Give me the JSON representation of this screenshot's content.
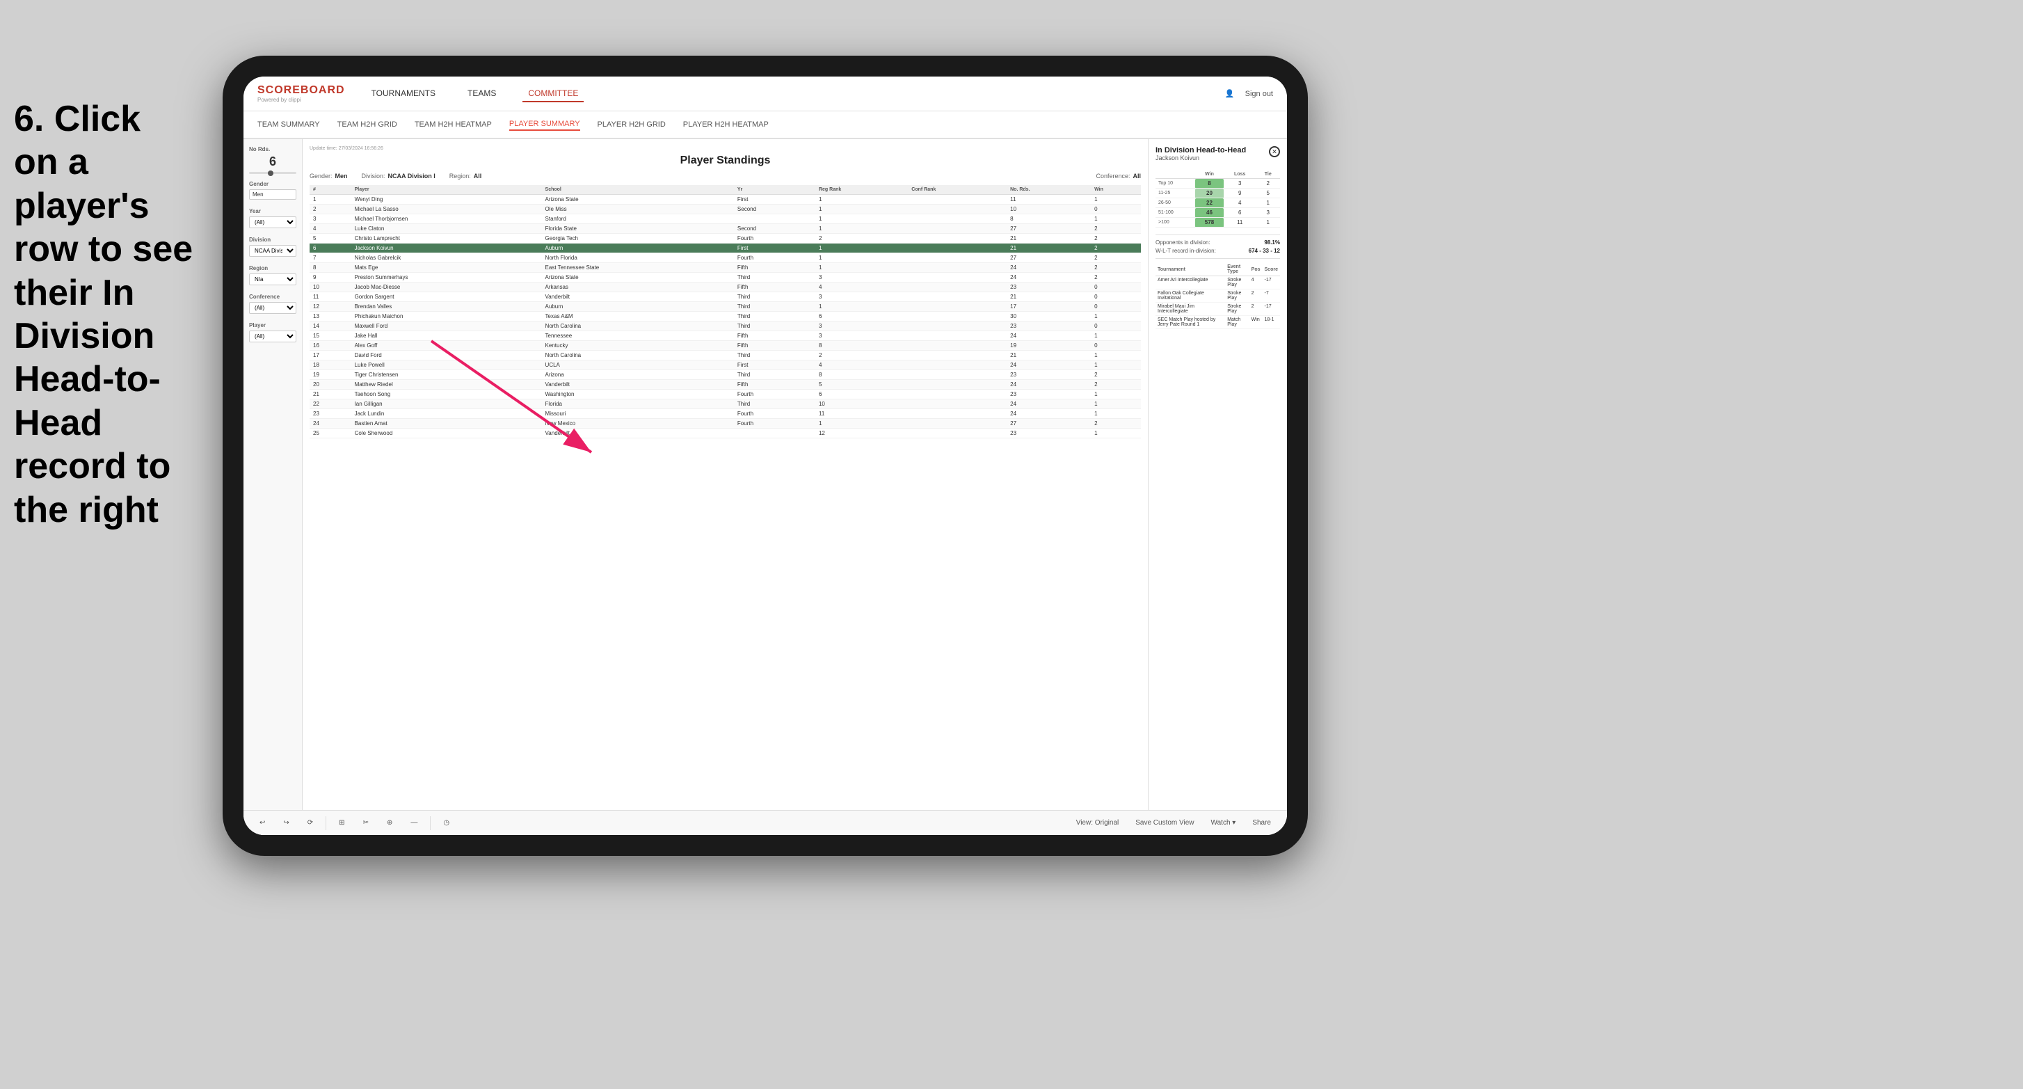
{
  "instruction": {
    "text": "6. Click on a player's row to see their In Division Head-to-Head record to the right"
  },
  "app": {
    "logo": "SCOREBOARD",
    "logo_sub": "Powered by clippi",
    "nav_items": [
      "TOURNAMENTS",
      "TEAMS",
      "COMMITTEE"
    ],
    "sign_out": "Sign out",
    "secondary_nav": [
      "TEAM SUMMARY",
      "TEAM H2H GRID",
      "TEAM H2H HEATMAP",
      "PLAYER SUMMARY",
      "PLAYER H2H GRID",
      "PLAYER H2H HEATMAP"
    ],
    "active_nav": "PLAYER SUMMARY"
  },
  "filters": {
    "no_rds_label": "No Rds.",
    "no_rds_value": "6",
    "gender_label": "Gender",
    "gender_value": "Men",
    "year_label": "Year",
    "year_value": "(All)",
    "division_label": "Division",
    "division_value": "NCAA Division I",
    "region_label": "Region",
    "region_value": "N/a",
    "conference_label": "Conference",
    "conference_value": "(All)",
    "player_label": "Player",
    "player_value": "(All)"
  },
  "standings": {
    "title": "Player Standings",
    "update_time": "Update time: 27/03/2024 16:56:26",
    "gender": "Men",
    "division": "NCAA Division I",
    "region": "All",
    "conference": "All",
    "columns": [
      "#",
      "Player",
      "School",
      "Yr",
      "Reg Rank",
      "Conf Rank",
      "No. Rds.",
      "Win"
    ],
    "rows": [
      {
        "num": 1,
        "player": "Wenyi Ding",
        "school": "Arizona State",
        "yr": "First",
        "reg_rank": 1,
        "conf_rank": "",
        "no_rds": 11,
        "win": 1
      },
      {
        "num": 2,
        "player": "Michael La Sasso",
        "school": "Ole Miss",
        "yr": "Second",
        "reg_rank": 1,
        "conf_rank": "",
        "no_rds": 10,
        "win": 0
      },
      {
        "num": 3,
        "player": "Michael Thorbjornsen",
        "school": "Stanford",
        "yr": "",
        "reg_rank": 1,
        "conf_rank": "",
        "no_rds": 8,
        "win": 1
      },
      {
        "num": 4,
        "player": "Luke Claton",
        "school": "Florida State",
        "yr": "Second",
        "reg_rank": 1,
        "conf_rank": "",
        "no_rds": 27,
        "win": 2
      },
      {
        "num": 5,
        "player": "Christo Lamprecht",
        "school": "Georgia Tech",
        "yr": "Fourth",
        "reg_rank": 2,
        "conf_rank": "",
        "no_rds": 21,
        "win": 2
      },
      {
        "num": 6,
        "player": "Jackson Koivun",
        "school": "Auburn",
        "yr": "First",
        "reg_rank": 1,
        "conf_rank": "",
        "no_rds": 21,
        "win": 2,
        "highlighted": true
      },
      {
        "num": 7,
        "player": "Nicholas Gabrelcik",
        "school": "North Florida",
        "yr": "Fourth",
        "reg_rank": 1,
        "conf_rank": "",
        "no_rds": 27,
        "win": 2
      },
      {
        "num": 8,
        "player": "Mats Ege",
        "school": "East Tennessee State",
        "yr": "Fifth",
        "reg_rank": 1,
        "conf_rank": "",
        "no_rds": 24,
        "win": 2
      },
      {
        "num": 9,
        "player": "Preston Summerhays",
        "school": "Arizona State",
        "yr": "Third",
        "reg_rank": 3,
        "conf_rank": "",
        "no_rds": 24,
        "win": 2
      },
      {
        "num": 10,
        "player": "Jacob Mac-Diesse",
        "school": "Arkansas",
        "yr": "Fifth",
        "reg_rank": 4,
        "conf_rank": "",
        "no_rds": 23,
        "win": 0
      },
      {
        "num": 11,
        "player": "Gordon Sargent",
        "school": "Vanderbilt",
        "yr": "Third",
        "reg_rank": 3,
        "conf_rank": "",
        "no_rds": 21,
        "win": 0
      },
      {
        "num": 12,
        "player": "Brendan Valles",
        "school": "Auburn",
        "yr": "Third",
        "reg_rank": 1,
        "conf_rank": "",
        "no_rds": 17,
        "win": 0
      },
      {
        "num": 13,
        "player": "Phichakun Maichon",
        "school": "Texas A&M",
        "yr": "Third",
        "reg_rank": 6,
        "conf_rank": "",
        "no_rds": 30,
        "win": 1
      },
      {
        "num": 14,
        "player": "Maxwell Ford",
        "school": "North Carolina",
        "yr": "Third",
        "reg_rank": 3,
        "conf_rank": "",
        "no_rds": 23,
        "win": 0
      },
      {
        "num": 15,
        "player": "Jake Hall",
        "school": "Tennessee",
        "yr": "Fifth",
        "reg_rank": 3,
        "conf_rank": "",
        "no_rds": 24,
        "win": 1
      },
      {
        "num": 16,
        "player": "Alex Goff",
        "school": "Kentucky",
        "yr": "Fifth",
        "reg_rank": 8,
        "conf_rank": "",
        "no_rds": 19,
        "win": 0
      },
      {
        "num": 17,
        "player": "David Ford",
        "school": "North Carolina",
        "yr": "Third",
        "reg_rank": 2,
        "conf_rank": "",
        "no_rds": 21,
        "win": 1
      },
      {
        "num": 18,
        "player": "Luke Powell",
        "school": "UCLA",
        "yr": "First",
        "reg_rank": 4,
        "conf_rank": "",
        "no_rds": 24,
        "win": 1
      },
      {
        "num": 19,
        "player": "Tiger Christensen",
        "school": "Arizona",
        "yr": "Third",
        "reg_rank": 8,
        "conf_rank": "",
        "no_rds": 23,
        "win": 2
      },
      {
        "num": 20,
        "player": "Matthew Riedel",
        "school": "Vanderbilt",
        "yr": "Fifth",
        "reg_rank": 5,
        "conf_rank": "",
        "no_rds": 24,
        "win": 2
      },
      {
        "num": 21,
        "player": "Taehoon Song",
        "school": "Washington",
        "yr": "Fourth",
        "reg_rank": 6,
        "conf_rank": "",
        "no_rds": 23,
        "win": 1
      },
      {
        "num": 22,
        "player": "Ian Gilligan",
        "school": "Florida",
        "yr": "Third",
        "reg_rank": 10,
        "conf_rank": "",
        "no_rds": 24,
        "win": 1
      },
      {
        "num": 23,
        "player": "Jack Lundin",
        "school": "Missouri",
        "yr": "Fourth",
        "reg_rank": 11,
        "conf_rank": "",
        "no_rds": 24,
        "win": 1
      },
      {
        "num": 24,
        "player": "Bastien Amat",
        "school": "New Mexico",
        "yr": "Fourth",
        "reg_rank": 1,
        "conf_rank": "",
        "no_rds": 27,
        "win": 2
      },
      {
        "num": 25,
        "player": "Cole Sherwood",
        "school": "Vanderbilt",
        "yr": "",
        "reg_rank": 12,
        "conf_rank": "",
        "no_rds": 23,
        "win": 1
      }
    ]
  },
  "h2h": {
    "title": "In Division Head-to-Head",
    "player_name": "Jackson Koivun",
    "table_headers": [
      "",
      "Win",
      "Loss",
      "Tie"
    ],
    "rows": [
      {
        "range": "Top 10",
        "win": 8,
        "loss": 3,
        "tie": 2,
        "win_strong": true
      },
      {
        "range": "11-25",
        "win": 20,
        "loss": 9,
        "tie": 5,
        "win_medium": true
      },
      {
        "range": "26-50",
        "win": 22,
        "loss": 4,
        "tie": 1,
        "win_strong": true
      },
      {
        "range": "51-100",
        "win": 46,
        "loss": 6,
        "tie": 3,
        "win_strong": true
      },
      {
        "range": ">100",
        "win": 578,
        "loss": 11,
        "tie": 1,
        "win_strong": true
      }
    ],
    "opponents_label": "Opponents in division:",
    "opponents_value": "98.1%",
    "wl_label": "W-L-T record in-division:",
    "wl_value": "674 - 33 - 12",
    "tournament_headers": [
      "Tournament",
      "Event Type",
      "Pos",
      "Score"
    ],
    "tournaments": [
      {
        "name": "Amer Ari Intercollegiate",
        "type": "Stroke Play",
        "pos": 4,
        "score": "-17"
      },
      {
        "name": "Fallon Oak Collegiate Invitational",
        "type": "Stroke Play",
        "pos": 2,
        "score": "-7"
      },
      {
        "name": "Mirabel Maui Jim Intercollegiate",
        "type": "Stroke Play",
        "pos": 2,
        "score": "-17"
      },
      {
        "name": "SEC Match Play hosted by Jerry Pate Round 1",
        "type": "Match Play",
        "pos": "Win",
        "score": "18-1"
      }
    ]
  },
  "toolbar": {
    "buttons": [
      "↩",
      "↪",
      "⟳",
      "⊞",
      "✂",
      "⊕",
      "—",
      "◷"
    ],
    "view_original": "View: Original",
    "save_custom": "Save Custom View",
    "watch": "Watch ▾",
    "share": "Share"
  }
}
